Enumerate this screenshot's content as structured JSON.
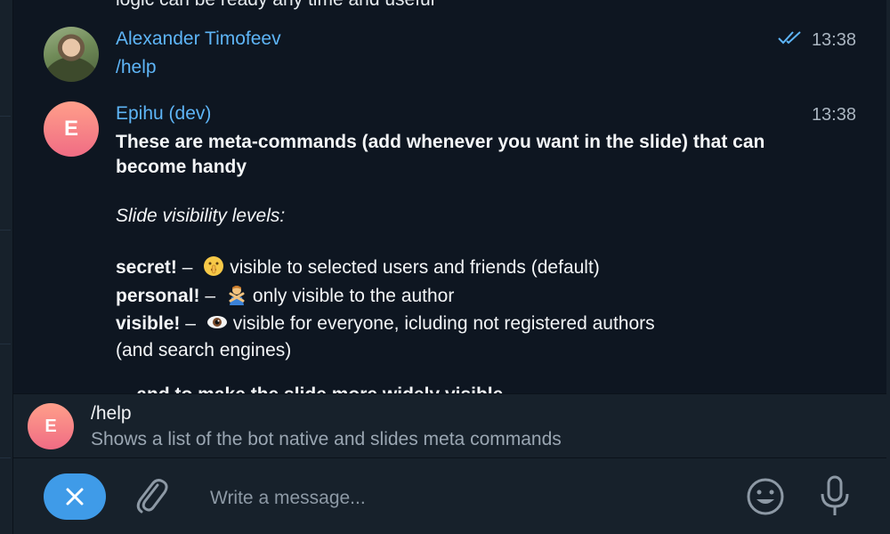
{
  "chat": {
    "cut_off_text": "logic can be ready any time and useful",
    "messages": [
      {
        "author": "Alexander Timofeev",
        "time": "13:38",
        "text": "/help",
        "read": true
      },
      {
        "author": "Epihu (dev)",
        "avatar_letter": "E",
        "time": "13:38",
        "intro": "These are meta-commands (add whenever you want in the slide) that can become handy",
        "visibility_heading": "Slide visibility levels:",
        "levels": [
          {
            "command": "secret!",
            "dash": " – ",
            "emoji": "shushing-face-icon",
            "description": "visible to selected users and friends (default)"
          },
          {
            "command": "personal!",
            "dash": " – ",
            "emoji": "person-gesturing-no-icon",
            "description": "only visible to the author"
          },
          {
            "command": "visible!",
            "dash": " – ",
            "emoji": "eye-icon",
            "description": "visible for everyone, icluding not registered authors"
          }
        ],
        "visible_continuation": "(and search engines)",
        "cut_off_next": "... and to make the slide more widely visible"
      }
    ]
  },
  "suggestion": {
    "avatar_letter": "E",
    "command": "/help",
    "description": "Shows a list of the bot native and slides meta commands"
  },
  "composer": {
    "placeholder": "Write a message...",
    "value": ""
  },
  "colors": {
    "background": "#0e1621",
    "panel": "#17212b",
    "accent": "#5eb5f7",
    "button": "#3f9be8"
  }
}
